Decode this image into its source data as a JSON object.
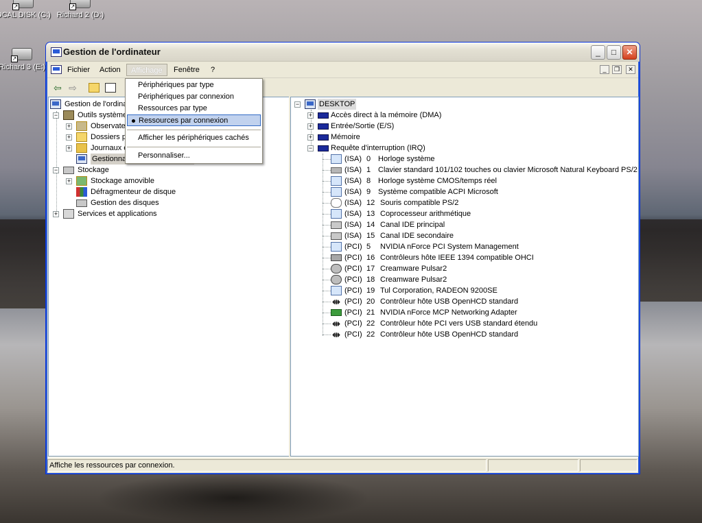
{
  "desktop": {
    "icons": [
      {
        "label": "OCAL DISK (C:)"
      },
      {
        "label": "Richard 2 (D:)"
      },
      {
        "label": "Richard 3 (E:)"
      }
    ]
  },
  "window": {
    "title": "Gestion de l'ordinateur",
    "buttons": {
      "minimize": "_",
      "maximize": "□",
      "close": "✕"
    }
  },
  "menubar": {
    "items": [
      "Fichier",
      "Action",
      "Affichage",
      "Fenêtre",
      "?"
    ],
    "active": "Affichage",
    "mdi": {
      "minimize": "_",
      "restore": "❐",
      "close": "✕"
    }
  },
  "toolbar": {
    "back": "⇦",
    "forward": "⇨"
  },
  "left_tree": {
    "root": "Gestion de l'ordinateur (local)",
    "items": [
      {
        "label": "Outils système"
      },
      {
        "label": "Observateur d'événements"
      },
      {
        "label": "Dossiers partagés"
      },
      {
        "label": "Journaux et alertes de performance"
      },
      {
        "label": "Gestionnaire de périphériques"
      },
      {
        "label": "Stockage"
      },
      {
        "label": "Stockage amovible"
      },
      {
        "label": "Défragmenteur de disque"
      },
      {
        "label": "Gestion des disques"
      },
      {
        "label": "Services et applications"
      }
    ]
  },
  "right_tree": {
    "root": "DESKTOP",
    "categories": [
      {
        "label": "Accès direct à la mémoire (DMA)"
      },
      {
        "label": "Entrée/Sortie (E/S)"
      },
      {
        "label": "Mémoire"
      },
      {
        "label": "Requête d'interruption (IRQ)"
      }
    ],
    "irq": [
      {
        "bus": "(ISA)",
        "num": "0",
        "device": "Horloge système",
        "icon": "mon"
      },
      {
        "bus": "(ISA)",
        "num": "1",
        "device": "Clavier standard 101/102 touches ou clavier Microsoft Natural Keyboard PS/2",
        "icon": "kbd"
      },
      {
        "bus": "(ISA)",
        "num": "8",
        "device": "Horloge système CMOS/temps réel",
        "icon": "mon"
      },
      {
        "bus": "(ISA)",
        "num": "9",
        "device": "Système compatible ACPI Microsoft",
        "icon": "mon"
      },
      {
        "bus": "(ISA)",
        "num": "12",
        "device": "Souris compatible PS/2",
        "icon": "mouse"
      },
      {
        "bus": "(ISA)",
        "num": "13",
        "device": "Coprocesseur arithmétique",
        "icon": "mon"
      },
      {
        "bus": "(ISA)",
        "num": "14",
        "device": "Canal IDE principal",
        "icon": "hd"
      },
      {
        "bus": "(ISA)",
        "num": "15",
        "device": "Canal IDE secondaire",
        "icon": "hd"
      },
      {
        "bus": "(PCI)",
        "num": "5",
        "device": "NVIDIA nForce PCI System Management",
        "icon": "mon"
      },
      {
        "bus": "(PCI)",
        "num": "16",
        "device": "Contrôleurs hôte IEEE 1394 compatible OHCI",
        "icon": "fw"
      },
      {
        "bus": "(PCI)",
        "num": "17",
        "device": "Creamware Pulsar2",
        "icon": "spk"
      },
      {
        "bus": "(PCI)",
        "num": "18",
        "device": "Creamware Pulsar2",
        "icon": "spk"
      },
      {
        "bus": "(PCI)",
        "num": "19",
        "device": "Tul Corporation, RADEON 9200SE",
        "icon": "mon"
      },
      {
        "bus": "(PCI)",
        "num": "20",
        "device": "Contrôleur hôte USB OpenHCD standard",
        "icon": "usb"
      },
      {
        "bus": "(PCI)",
        "num": "21",
        "device": "NVIDIA nForce MCP Networking Adapter",
        "icon": "net"
      },
      {
        "bus": "(PCI)",
        "num": "22",
        "device": "Contrôleur hôte PCI vers USB standard étendu",
        "icon": "usb"
      },
      {
        "bus": "(PCI)",
        "num": "22",
        "device": "Contrôleur hôte USB OpenHCD standard",
        "icon": "usb"
      }
    ]
  },
  "view_menu": {
    "items": [
      {
        "label": "Périphériques par type"
      },
      {
        "label": "Périphériques par connexion"
      },
      {
        "label": "Ressources par type"
      },
      {
        "label": "Ressources par connexion"
      },
      {
        "label": "Afficher les périphériques cachés"
      },
      {
        "label": "Personnaliser..."
      }
    ]
  },
  "statusbar": {
    "text": "Affiche les ressources par connexion."
  }
}
